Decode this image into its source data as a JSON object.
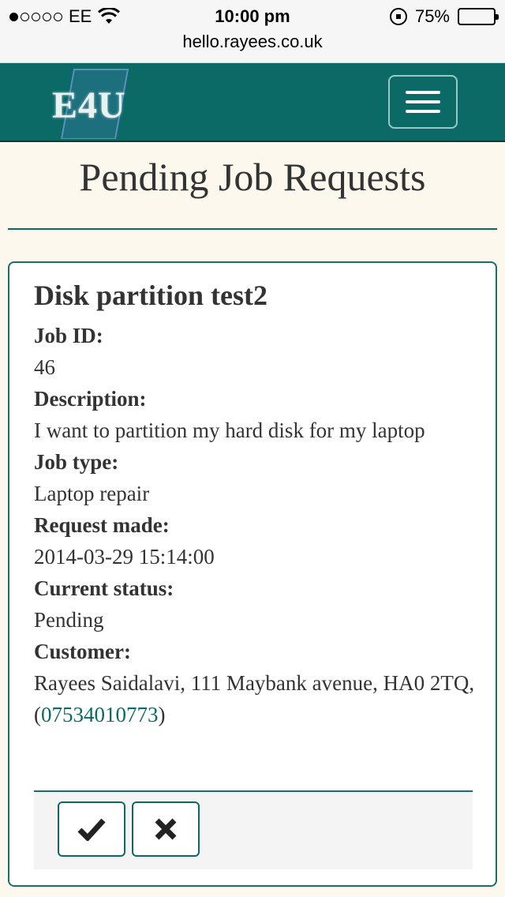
{
  "status_bar": {
    "carrier": "EE",
    "time": "10:00 pm",
    "battery": "75%",
    "battery_level": 0.75,
    "signal_bars": 1
  },
  "browser": {
    "url": "hello.rayees.co.uk"
  },
  "navbar": {
    "logo_text": "E4U",
    "brand_color": "#0b6a66"
  },
  "page": {
    "title": "Pending Job Requests"
  },
  "job": {
    "title": "Disk partition test2",
    "fields": [
      {
        "label": "Job ID:",
        "value": "46"
      },
      {
        "label": "Description:",
        "value": "I want to partition my hard disk for my laptop"
      },
      {
        "label": "Job type:",
        "value": "Laptop repair"
      },
      {
        "label": "Request made:",
        "value": "2014-03-29 15:14:00"
      },
      {
        "label": "Current status:",
        "value": "Pending"
      }
    ],
    "customer": {
      "label": "Customer:",
      "value_prefix": "Rayees Saidalavi, 111 Maybank avenue, HA0 2TQ, (",
      "phone": "07534010773",
      "value_suffix": ")"
    }
  },
  "actions": {
    "accept_icon": "check-icon",
    "reject_icon": "x-icon"
  }
}
